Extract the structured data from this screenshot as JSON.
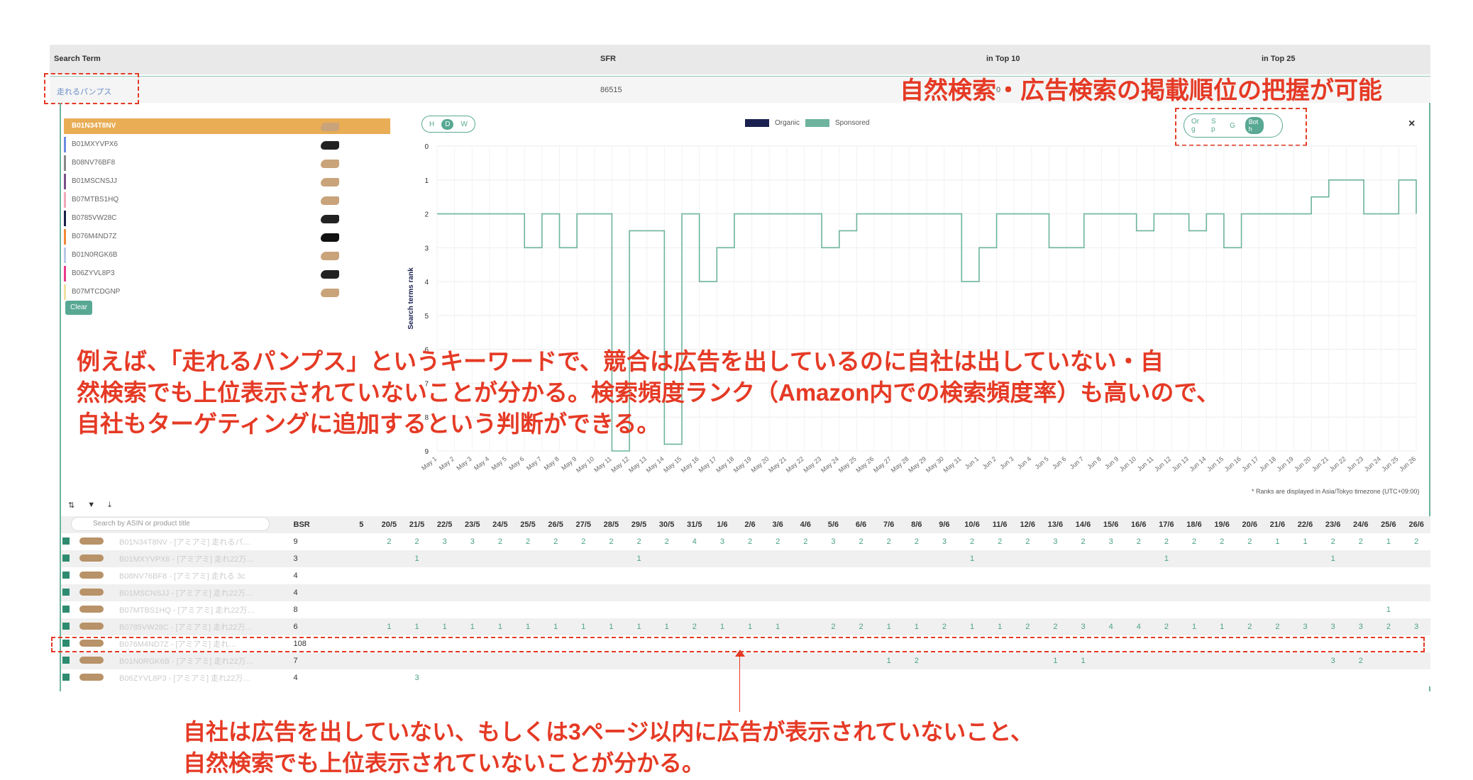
{
  "header": {
    "search_term": "Search Term",
    "sfr": "SFR",
    "in_top10": "in Top 10",
    "in_top25": "in Top 25"
  },
  "row": {
    "term": "走れるパンプス",
    "sfr": "86515",
    "top10": "0"
  },
  "annotation_top": "自然検索・広告検索の掲載順位の把握が可能",
  "annotation_mid": [
    "例えば、「走れるパンプス」というキーワードで、競合は広告を出しているのに自社は出していない・自",
    "然検索でも上位表示されていないことが分かる。検索頻度ランク（Amazon内での検索頻度率）も高いので、",
    "自社もターゲティングに追加するという判断ができる。"
  ],
  "annotation_bottom": [
    "自社は広告を出していない、もしくは3ページ以内に広告が表示されていないこと、",
    "自然検索でも上位表示されていないことが分かる。"
  ],
  "asins": [
    {
      "id": "B01N34T8NV",
      "color": "#e8ad55",
      "selected": true
    },
    {
      "id": "B01MXYVPX6",
      "color": "#6b8ce0"
    },
    {
      "id": "B08NV76BF8",
      "color": "#888888"
    },
    {
      "id": "B01MSCNSJJ",
      "color": "#7a4f8a"
    },
    {
      "id": "B07MTBS1HQ",
      "color": "#f0a8b8"
    },
    {
      "id": "B0785VW28C",
      "color": "#1a1f4a"
    },
    {
      "id": "B076M4ND7Z",
      "color": "#f08a3a"
    },
    {
      "id": "B01N0RGK6B",
      "color": "#b8c8e8"
    },
    {
      "id": "B06ZYVL8P3",
      "color": "#e83a8a"
    },
    {
      "id": "B07MTCDGNP",
      "color": "#f0e0a0"
    }
  ],
  "clear_label": "Clear",
  "view_toggle": [
    "H",
    "D",
    "W"
  ],
  "type_toggle": [
    "Or g",
    "S p",
    "G",
    "Bot h"
  ],
  "legend": [
    {
      "name": "Organic",
      "color": "#1a2150"
    },
    {
      "name": "Sponsored",
      "color": "#6db39d"
    }
  ],
  "close_label": "×",
  "note": "* Ranks are displayed in Asia/Tokyo timezone (UTC+09:00)",
  "chart_data": {
    "type": "line",
    "ylabel": "Search terms rank",
    "ylim": [
      0,
      9
    ],
    "y_ticks": [
      "0",
      "1",
      "2",
      "3",
      "4",
      "5",
      "6",
      "7",
      "8",
      "9"
    ],
    "x": [
      "May 1",
      "May 2",
      "May 3",
      "May 4",
      "May 5",
      "May 6",
      "May 7",
      "May 8",
      "May 9",
      "May 10",
      "May 11",
      "May 12",
      "May 13",
      "May 14",
      "May 15",
      "May 16",
      "May 17",
      "May 18",
      "May 19",
      "May 20",
      "May 21",
      "May 22",
      "May 23",
      "May 24",
      "May 25",
      "May 26",
      "May 27",
      "May 28",
      "May 29",
      "May 30",
      "May 31",
      "Jun 1",
      "Jun 2",
      "Jun 3",
      "Jun 4",
      "Jun 5",
      "Jun 6",
      "Jun 7",
      "Jun 8",
      "Jun 9",
      "Jun 10",
      "Jun 11",
      "Jun 12",
      "Jun 13",
      "Jun 14",
      "Jun 15",
      "Jun 16",
      "Jun 17",
      "Jun 18",
      "Jun 19",
      "Jun 20",
      "Jun 21",
      "Jun 22",
      "Jun 23",
      "Jun 24",
      "Jun 25",
      "Jun 26"
    ],
    "series": [
      {
        "name": "Sponsored",
        "color": "#6db39d",
        "values": [
          2,
          2,
          2,
          2,
          2,
          3,
          2,
          3,
          2,
          2,
          9,
          2.5,
          2.5,
          8.8,
          2,
          4,
          3,
          2,
          2,
          2,
          2,
          2,
          3,
          2.5,
          2,
          2,
          2,
          2,
          2,
          2,
          4,
          3,
          2,
          2,
          2,
          3,
          3,
          2,
          2,
          2,
          2.5,
          2,
          2,
          2.5,
          2,
          3,
          2,
          2,
          2,
          2,
          1.5,
          1,
          1,
          2,
          2,
          1,
          2
        ]
      }
    ]
  },
  "table": {
    "search_placeholder": "Search by ASIN or product title",
    "bsr_label": "BSR",
    "dates": [
      "5",
      "20/5",
      "21/5",
      "22/5",
      "23/5",
      "24/5",
      "25/5",
      "26/5",
      "27/5",
      "28/5",
      "29/5",
      "30/5",
      "31/5",
      "1/6",
      "2/6",
      "3/6",
      "4/6",
      "5/6",
      "6/6",
      "7/6",
      "8/6",
      "9/6",
      "10/6",
      "11/6",
      "12/6",
      "13/6",
      "14/6",
      "15/6",
      "16/6",
      "17/6",
      "18/6",
      "19/6",
      "20/6",
      "21/6",
      "22/6",
      "23/6",
      "24/6",
      "25/6",
      "26/6"
    ],
    "rows": [
      {
        "name": "B01N34T8NV - [アミアミ] 走れるパ…",
        "bsr": "9",
        "vals": [
          "",
          "2",
          "2",
          "3",
          "3",
          "2",
          "2",
          "2",
          "2",
          "2",
          "2",
          "2",
          "4",
          "3",
          "2",
          "2",
          "2",
          "3",
          "2",
          "2",
          "2",
          "3",
          "2",
          "2",
          "2",
          "3",
          "2",
          "3",
          "2",
          "2",
          "2",
          "2",
          "2",
          "1",
          "1",
          "2",
          "2",
          "1",
          "2"
        ]
      },
      {
        "name": "B01MXYVPX6 - [アミアミ] 走れ22万…",
        "bsr": "3",
        "vals": [
          "",
          "",
          "1",
          "",
          "",
          "",
          "",
          "",
          "",
          "",
          "1",
          "",
          "",
          "",
          "",
          "",
          "",
          "",
          "",
          "",
          "",
          "",
          "1",
          "",
          "",
          "",
          "",
          "",
          "",
          "1",
          "",
          "",
          "",
          "",
          "",
          "1",
          "",
          "",
          ""
        ]
      },
      {
        "name": "B08NV76BF8 - [アミアミ] 走れる 3c",
        "bsr": "4",
        "vals": []
      },
      {
        "name": "B01MSCNSJJ - [アミアミ] 走れ22万…",
        "bsr": "4",
        "vals": []
      },
      {
        "name": "B07MTBS1HQ - [アミアミ] 走れ22万…",
        "bsr": "8",
        "vals": [
          "",
          "",
          "",
          "",
          "",
          "",
          "",
          "",
          "",
          "",
          "",
          "",
          "",
          "",
          "",
          "",
          "",
          "",
          "",
          "",
          "",
          "",
          "",
          "",
          "",
          "",
          "",
          "",
          "",
          "",
          "",
          "",
          "",
          "",
          "",
          "",
          "",
          "1",
          ""
        ]
      },
      {
        "name": "B0785VW28C - [アミアミ] 走れ22万…",
        "bsr": "6",
        "vals": [
          "",
          "1",
          "1",
          "1",
          "1",
          "1",
          "1",
          "1",
          "1",
          "1",
          "1",
          "1",
          "2",
          "1",
          "1",
          "1",
          "",
          "2",
          "2",
          "1",
          "1",
          "2",
          "1",
          "1",
          "2",
          "2",
          "3",
          "4",
          "4",
          "2",
          "1",
          "1",
          "2",
          "2",
          "3",
          "3",
          "3",
          "2",
          "3"
        ]
      },
      {
        "name": "B076M4ND7Z - [アミアミ] 走れ…",
        "bsr": "108",
        "vals": []
      },
      {
        "name": "B01N0RGK6B - [アミアミ] 走れ22万…",
        "bsr": "7",
        "vals": [
          "",
          "",
          "",
          "",
          "",
          "",
          "",
          "",
          "",
          "",
          "",
          "",
          "",
          "",
          "",
          "",
          "",
          "",
          "",
          "1",
          "2",
          "",
          "",
          "",
          "",
          "1",
          "1",
          "",
          "",
          "",
          "",
          "",
          "",
          "",
          "",
          "3",
          "2",
          "",
          ""
        ]
      },
      {
        "name": "B06ZYVL8P3 - [アミアミ] 走れ22万…",
        "bsr": "4",
        "vals": [
          "",
          "",
          "3"
        ]
      }
    ]
  }
}
